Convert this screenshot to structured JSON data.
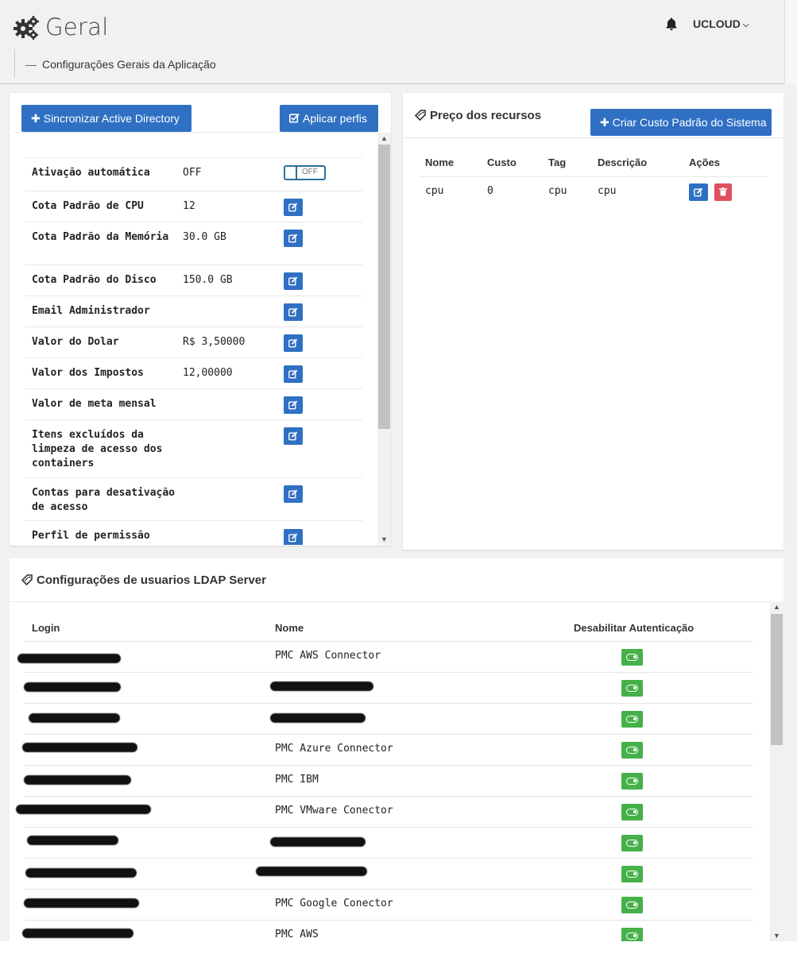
{
  "header": {
    "title": "Geral",
    "user": "UCLOUD",
    "breadcrumb": "Configurações Gerais da Aplicação"
  },
  "config_panel": {
    "sync_button": "Sincronizar Active Directory",
    "apply_button": "Aplicar perfis",
    "toggle_off_label": "OFF",
    "rows": [
      {
        "label": "Ativação automática",
        "value": "OFF",
        "control": "toggle"
      },
      {
        "label": "Cota Padrão de CPU",
        "value": "12",
        "control": "edit"
      },
      {
        "label": "Cota Padrão da Memória",
        "value": "30.0 GB",
        "control": "edit"
      },
      {
        "label": "Cota Padrão do Disco",
        "value": "150.0 GB",
        "control": "edit"
      },
      {
        "label": "Email Administrador",
        "value": "",
        "control": "edit"
      },
      {
        "label": "Valor do Dolar",
        "value": "R$ 3,50000",
        "control": "edit"
      },
      {
        "label": "Valor dos Impostos",
        "value": "12,00000",
        "control": "edit"
      },
      {
        "label": "Valor de meta mensal",
        "value": "",
        "control": "edit"
      },
      {
        "label": "Itens excluídos da limpeza de acesso dos containers",
        "value": "",
        "control": "edit"
      },
      {
        "label": "Contas para desativação de acesso",
        "value": "",
        "control": "edit"
      },
      {
        "label": "Perfil de permissão",
        "value": "",
        "control": "edit"
      }
    ]
  },
  "pricing": {
    "title": "Preço dos recursos",
    "create_button": "Criar Custo Padrão do Sistema",
    "columns": [
      "Nome",
      "Custo",
      "Tag",
      "Descrição",
      "Ações"
    ],
    "rows": [
      {
        "nome": "cpu",
        "custo": "0",
        "tag": "cpu",
        "descricao": "cpu"
      }
    ]
  },
  "ldap": {
    "title": "Configurações de usuarios LDAP Server",
    "columns": [
      "Login",
      "Nome",
      "Desabilitar Autenticação"
    ],
    "rows": [
      {
        "nome": "PMC AWS Connector"
      },
      {
        "nome": ""
      },
      {
        "nome": ""
      },
      {
        "nome": "PMC Azure Connector"
      },
      {
        "nome": "PMC IBM"
      },
      {
        "nome": "PMC VMware Conector"
      },
      {
        "nome": ""
      },
      {
        "nome": ""
      },
      {
        "nome": "PMC Google Conector"
      },
      {
        "nome": "PMC AWS"
      }
    ]
  },
  "colors": {
    "primary": "#2f70c3",
    "danger": "#e0505e",
    "success": "#46b14a",
    "background": "#f1f1f1"
  }
}
